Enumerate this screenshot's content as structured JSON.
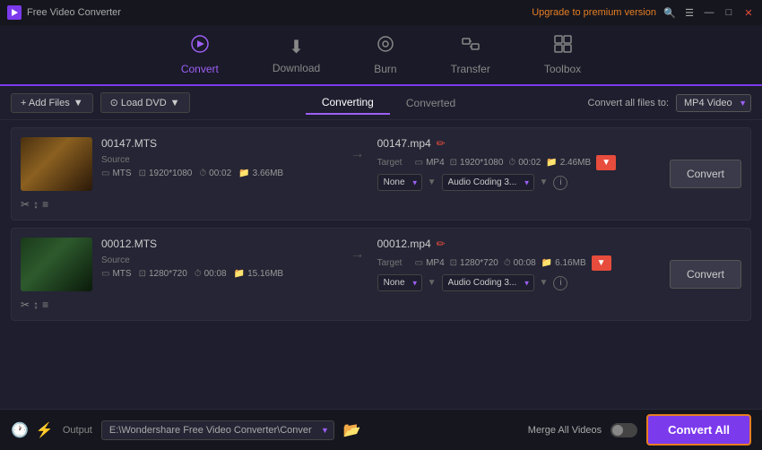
{
  "titlebar": {
    "app_name": "Free Video Converter",
    "upgrade_text": "Upgrade to premium version",
    "buttons": [
      "search",
      "menu",
      "minimize",
      "maximize",
      "close"
    ]
  },
  "nav": {
    "items": [
      {
        "id": "convert",
        "label": "Convert",
        "icon": "⭮",
        "active": true
      },
      {
        "id": "download",
        "label": "Download",
        "icon": "⬇"
      },
      {
        "id": "burn",
        "label": "Burn",
        "icon": "⊙"
      },
      {
        "id": "transfer",
        "label": "Transfer",
        "icon": "⇄"
      },
      {
        "id": "toolbox",
        "label": "Toolbox",
        "icon": "⊞"
      }
    ]
  },
  "toolbar": {
    "add_files_label": "+ Add Files",
    "load_dvd_label": "⊙ Load DVD",
    "converting_tab": "Converting",
    "converted_tab": "Converted",
    "convert_all_files_label": "Convert all files to:",
    "format_value": "MP4 Video"
  },
  "files": [
    {
      "source_name": "00147.MTS",
      "target_name": "00147.mp4",
      "source_format": "MTS",
      "source_res": "1920*1080",
      "source_duration": "00:02",
      "source_size": "3.66MB",
      "target_format": "MP4",
      "target_res": "1920*1080",
      "target_duration": "00:02",
      "target_size": "2.46MB",
      "video_preset": "None",
      "audio_preset": "Audio Coding 3...",
      "convert_label": "Convert"
    },
    {
      "source_name": "00012.MTS",
      "target_name": "00012.mp4",
      "source_format": "MTS",
      "source_res": "1280*720",
      "source_duration": "00:08",
      "source_size": "15.16MB",
      "target_format": "MP4",
      "target_res": "1280*720",
      "target_duration": "00:08",
      "target_size": "6.16MB",
      "video_preset": "None",
      "audio_preset": "Audio Coding 3...",
      "convert_label": "Convert"
    }
  ],
  "footer": {
    "output_label": "Output",
    "output_path": "E:\\Wondershare Free Video Converter\\Converted",
    "merge_label": "Merge All Videos",
    "convert_all_label": "Convert All"
  },
  "colors": {
    "accent": "#7c3aed",
    "accent_light": "#9d5ff5",
    "orange": "#e67e22",
    "danger": "#e74c3c"
  }
}
